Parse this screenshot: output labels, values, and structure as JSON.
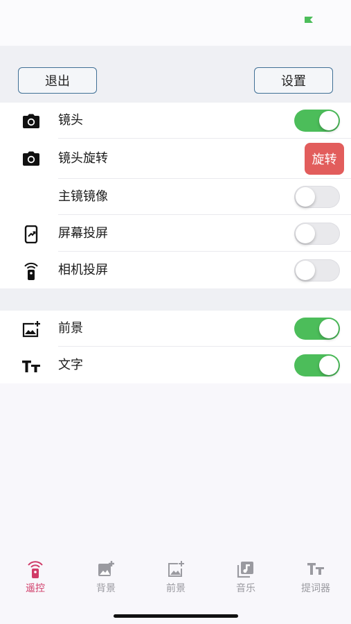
{
  "header": {
    "exit_label": "退出",
    "settings_label": "设置"
  },
  "camera_group": {
    "rows": [
      {
        "label": "镜头",
        "icon": "camera-icon",
        "toggle": true
      },
      {
        "label": "镜头旋转",
        "icon": "camera-icon",
        "action_label": "旋转"
      },
      {
        "label": "主镜镜像",
        "icon": "",
        "toggle": false
      },
      {
        "label": "屏幕投屏",
        "icon": "screen-cast-icon",
        "toggle": false
      },
      {
        "label": "相机投屏",
        "icon": "remote-cast-icon",
        "toggle": false
      }
    ]
  },
  "overlay_group": {
    "rows": [
      {
        "label": "前景",
        "icon": "add-image-icon",
        "toggle": true
      },
      {
        "label": "文字",
        "icon": "text-size-icon",
        "toggle": true
      }
    ]
  },
  "tabs": [
    {
      "label": "遥控",
      "icon": "remote-icon",
      "active": true
    },
    {
      "label": "背景",
      "icon": "background-image-icon",
      "active": false
    },
    {
      "label": "前景",
      "icon": "foreground-image-icon",
      "active": false
    },
    {
      "label": "音乐",
      "icon": "music-icon",
      "active": false
    },
    {
      "label": "提词器",
      "icon": "teleprompter-icon",
      "active": false
    }
  ],
  "colors": {
    "toggle_on": "#4cbd5a",
    "rotate_button": "#e25d5c",
    "tab_active": "#d03c68",
    "tab_inactive": "#9a9aa0"
  }
}
